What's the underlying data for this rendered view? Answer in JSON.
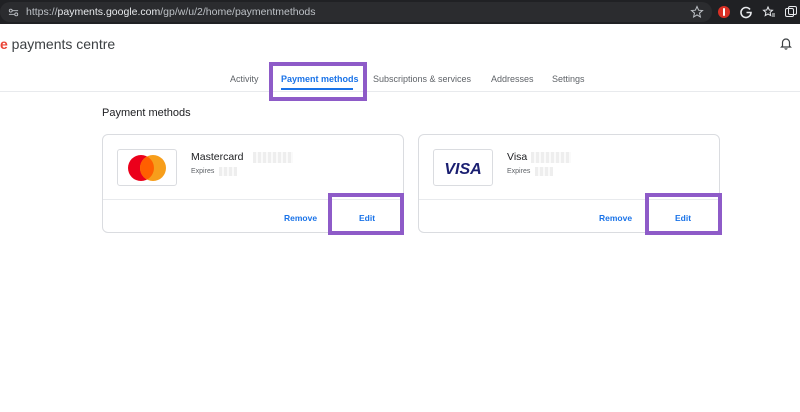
{
  "browser": {
    "url_scheme": "https://",
    "url_host": "payments.google.com",
    "url_path": "/gp/w/u/2/home/paymentmethods"
  },
  "header": {
    "brand_letter": "e",
    "brand_text": " payments centre"
  },
  "tabs": [
    {
      "label": "Activity"
    },
    {
      "label": "Payment methods",
      "active": true
    },
    {
      "label": "Subscriptions & services"
    },
    {
      "label": "Addresses"
    },
    {
      "label": "Settings"
    }
  ],
  "section_title": "Payment methods",
  "cards": [
    {
      "name": "Mastercard",
      "expires_label": "Expires",
      "logo": "mastercard-logo",
      "remove_label": "Remove",
      "edit_label": "Edit"
    },
    {
      "name": "Visa",
      "expires_label": "Expires",
      "logo": "visa-logo",
      "logo_text": "VISA",
      "remove_label": "Remove",
      "edit_label": "Edit"
    }
  ],
  "colors": {
    "accent": "#1a73e8",
    "highlight": "#8e5bc8",
    "brand_red": "#ea4335"
  }
}
